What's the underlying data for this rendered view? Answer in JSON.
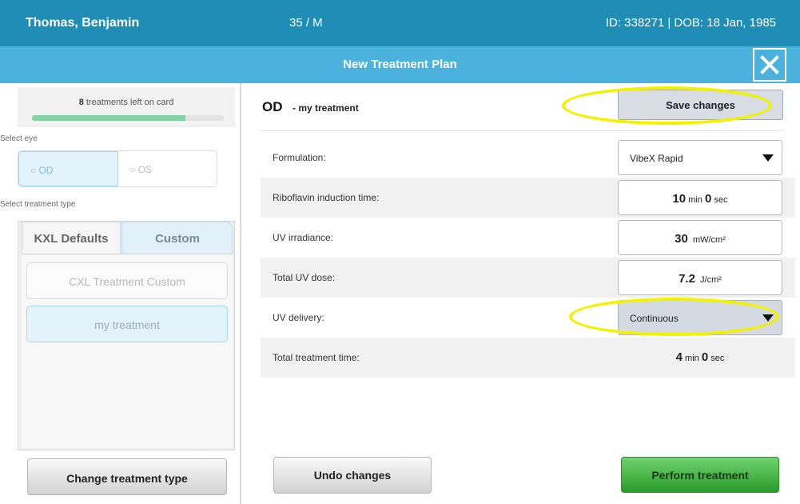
{
  "patient": {
    "name": "Thomas, Benjamin",
    "age_sex": "35 / M",
    "id_dob": "ID: 338271 | DOB: 18 Jan, 1985"
  },
  "header": {
    "title": "New Treatment Plan",
    "close_icon": "close-icon"
  },
  "sidebar": {
    "card": {
      "count": "8",
      "text": " treatments left on card",
      "progress_fraction": 0.8
    },
    "select_eye_label": "Select eye",
    "eyes": [
      {
        "label": "OD",
        "selected": true
      },
      {
        "label": "OS",
        "selected": false
      }
    ],
    "select_type_label": "Select treatment type",
    "tabs": [
      {
        "label": "KXL Defaults",
        "selected": false
      },
      {
        "label": "Custom",
        "selected": true
      }
    ],
    "treatments": [
      {
        "label": "CXL Treatment Custom",
        "selected": false
      },
      {
        "label": "my treatment",
        "selected": true
      }
    ],
    "change_type_button": "Change treatment type"
  },
  "main": {
    "eye": "OD",
    "treatment_name": "- my treatment",
    "save_button": "Save changes",
    "rows": {
      "formulation": {
        "label": "Formulation:",
        "value": "VibeX Rapid"
      },
      "induction": {
        "label": "Riboflavin induction time:",
        "minutes": "10",
        "min_unit": "min",
        "seconds": "0",
        "sec_unit": "sec"
      },
      "irradiance": {
        "label": "UV irradiance:",
        "value": "30",
        "unit": "mW/cm²"
      },
      "dose": {
        "label": "Total UV dose:",
        "value": "7.2",
        "unit": "J/cm²"
      },
      "delivery": {
        "label": "UV delivery:",
        "value": "Continuous"
      },
      "total_time": {
        "label": "Total treatment time:",
        "minutes": "4",
        "min_unit": "min",
        "seconds": "0",
        "sec_unit": "sec"
      }
    },
    "undo_button": "Undo changes",
    "perform_button": "Perform treatment"
  },
  "colors": {
    "patient_bar": "#1f8db5",
    "title_bar": "#4ab2dd",
    "highlight": "#f2f200",
    "perform_green": "#2a9b2a"
  }
}
